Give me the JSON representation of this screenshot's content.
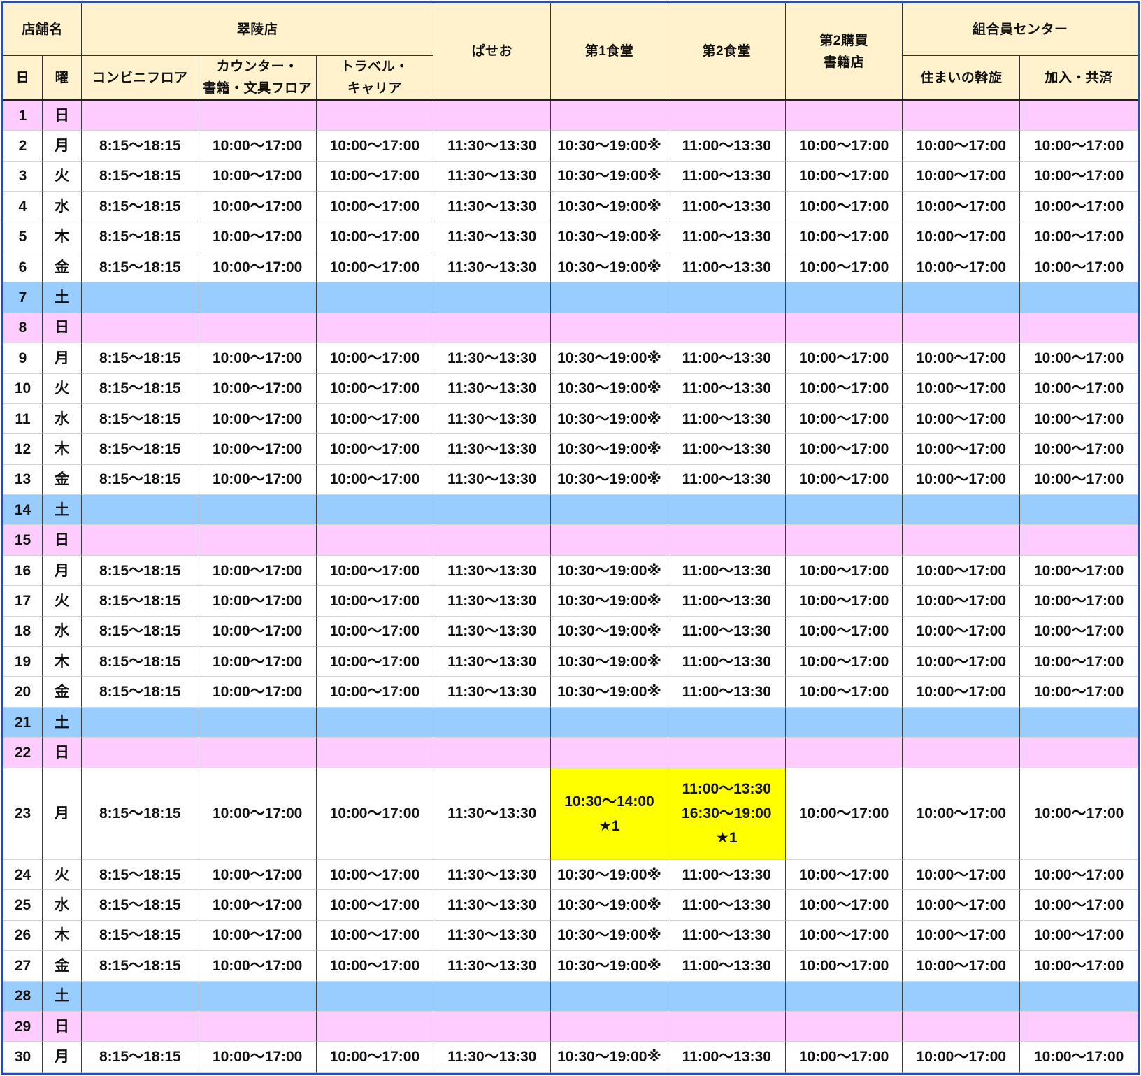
{
  "colors": {
    "frame": "#2B4FA8",
    "header_bg": "#FFF2CC",
    "sunday_bg": "#FFCCFF",
    "saturday_bg": "#99CCFF",
    "highlight_bg": "#FFFF00"
  },
  "header": {
    "store_name": "店舗名",
    "day": "日",
    "weekday": "曜",
    "groups": {
      "suiryo": "翠陵店",
      "member_center": "組合員センター"
    },
    "columns": [
      "コンビニフロア",
      "カウンター・\n書籍・文具フロア",
      "トラベル・\nキャリア",
      "ぱせお",
      "第1食堂",
      "第2食堂",
      "第2購買\n書籍店",
      "住まいの斡旋",
      "加入・共済"
    ]
  },
  "rows": [
    {
      "day": "1",
      "weekday": "日",
      "type": "sunday",
      "cells": []
    },
    {
      "day": "2",
      "weekday": "月",
      "type": "weekday",
      "cells": [
        "8:15～18:15",
        "10:00～17:00",
        "10:00～17:00",
        "11:30～13:30",
        "10:30～19:00※",
        "11:00～13:30",
        "10:00～17:00",
        "10:00～17:00",
        "10:00～17:00"
      ]
    },
    {
      "day": "3",
      "weekday": "火",
      "type": "weekday",
      "cells": [
        "8:15～18:15",
        "10:00～17:00",
        "10:00～17:00",
        "11:30～13:30",
        "10:30～19:00※",
        "11:00～13:30",
        "10:00～17:00",
        "10:00～17:00",
        "10:00～17:00"
      ]
    },
    {
      "day": "4",
      "weekday": "水",
      "type": "weekday",
      "cells": [
        "8:15～18:15",
        "10:00～17:00",
        "10:00～17:00",
        "11:30～13:30",
        "10:30～19:00※",
        "11:00～13:30",
        "10:00～17:00",
        "10:00～17:00",
        "10:00～17:00"
      ]
    },
    {
      "day": "5",
      "weekday": "木",
      "type": "weekday",
      "cells": [
        "8:15～18:15",
        "10:00～17:00",
        "10:00～17:00",
        "11:30～13:30",
        "10:30～19:00※",
        "11:00～13:30",
        "10:00～17:00",
        "10:00～17:00",
        "10:00～17:00"
      ]
    },
    {
      "day": "6",
      "weekday": "金",
      "type": "weekday",
      "cells": [
        "8:15～18:15",
        "10:00～17:00",
        "10:00～17:00",
        "11:30～13:30",
        "10:30～19:00※",
        "11:00～13:30",
        "10:00～17:00",
        "10:00～17:00",
        "10:00～17:00"
      ]
    },
    {
      "day": "7",
      "weekday": "土",
      "type": "saturday",
      "cells": []
    },
    {
      "day": "8",
      "weekday": "日",
      "type": "sunday",
      "cells": []
    },
    {
      "day": "9",
      "weekday": "月",
      "type": "weekday",
      "cells": [
        "8:15～18:15",
        "10:00～17:00",
        "10:00～17:00",
        "11:30～13:30",
        "10:30～19:00※",
        "11:00～13:30",
        "10:00～17:00",
        "10:00～17:00",
        "10:00～17:00"
      ]
    },
    {
      "day": "10",
      "weekday": "火",
      "type": "weekday",
      "cells": [
        "8:15～18:15",
        "10:00～17:00",
        "10:00～17:00",
        "11:30～13:30",
        "10:30～19:00※",
        "11:00～13:30",
        "10:00～17:00",
        "10:00～17:00",
        "10:00～17:00"
      ]
    },
    {
      "day": "11",
      "weekday": "水",
      "type": "weekday",
      "cells": [
        "8:15～18:15",
        "10:00～17:00",
        "10:00～17:00",
        "11:30～13:30",
        "10:30～19:00※",
        "11:00～13:30",
        "10:00～17:00",
        "10:00～17:00",
        "10:00～17:00"
      ]
    },
    {
      "day": "12",
      "weekday": "木",
      "type": "weekday",
      "cells": [
        "8:15～18:15",
        "10:00～17:00",
        "10:00～17:00",
        "11:30～13:30",
        "10:30～19:00※",
        "11:00～13:30",
        "10:00～17:00",
        "10:00～17:00",
        "10:00～17:00"
      ]
    },
    {
      "day": "13",
      "weekday": "金",
      "type": "weekday",
      "cells": [
        "8:15～18:15",
        "10:00～17:00",
        "10:00～17:00",
        "11:30～13:30",
        "10:30～19:00※",
        "11:00～13:30",
        "10:00～17:00",
        "10:00～17:00",
        "10:00～17:00"
      ]
    },
    {
      "day": "14",
      "weekday": "土",
      "type": "saturday",
      "cells": []
    },
    {
      "day": "15",
      "weekday": "日",
      "type": "sunday",
      "cells": []
    },
    {
      "day": "16",
      "weekday": "月",
      "type": "weekday",
      "cells": [
        "8:15～18:15",
        "10:00～17:00",
        "10:00～17:00",
        "11:30～13:30",
        "10:30～19:00※",
        "11:00～13:30",
        "10:00～17:00",
        "10:00～17:00",
        "10:00～17:00"
      ]
    },
    {
      "day": "17",
      "weekday": "火",
      "type": "weekday",
      "cells": [
        "8:15～18:15",
        "10:00～17:00",
        "10:00～17:00",
        "11:30～13:30",
        "10:30～19:00※",
        "11:00～13:30",
        "10:00～17:00",
        "10:00～17:00",
        "10:00～17:00"
      ]
    },
    {
      "day": "18",
      "weekday": "水",
      "type": "weekday",
      "cells": [
        "8:15～18:15",
        "10:00～17:00",
        "10:00～17:00",
        "11:30～13:30",
        "10:30～19:00※",
        "11:00～13:30",
        "10:00～17:00",
        "10:00～17:00",
        "10:00～17:00"
      ]
    },
    {
      "day": "19",
      "weekday": "木",
      "type": "weekday",
      "cells": [
        "8:15～18:15",
        "10:00～17:00",
        "10:00～17:00",
        "11:30～13:30",
        "10:30～19:00※",
        "11:00～13:30",
        "10:00～17:00",
        "10:00～17:00",
        "10:00～17:00"
      ]
    },
    {
      "day": "20",
      "weekday": "金",
      "type": "weekday",
      "cells": [
        "8:15～18:15",
        "10:00～17:00",
        "10:00～17:00",
        "11:30～13:30",
        "10:30～19:00※",
        "11:00～13:30",
        "10:00～17:00",
        "10:00～17:00",
        "10:00～17:00"
      ]
    },
    {
      "day": "21",
      "weekday": "土",
      "type": "saturday",
      "cells": []
    },
    {
      "day": "22",
      "weekday": "日",
      "type": "sunday",
      "cells": []
    },
    {
      "day": "23",
      "weekday": "月",
      "type": "weekday",
      "cells": [
        "8:15～18:15",
        "10:00～17:00",
        "10:00～17:00",
        "11:30～13:30",
        "10:30～14:00\n★1",
        "11:00～13:30\n16:30～19:00\n★1",
        "10:00～17:00",
        "10:00～17:00",
        "10:00～17:00"
      ],
      "highlighted_cells": [
        4,
        5
      ]
    },
    {
      "day": "24",
      "weekday": "火",
      "type": "weekday",
      "cells": [
        "8:15～18:15",
        "10:00～17:00",
        "10:00～17:00",
        "11:30～13:30",
        "10:30～19:00※",
        "11:00～13:30",
        "10:00～17:00",
        "10:00～17:00",
        "10:00～17:00"
      ]
    },
    {
      "day": "25",
      "weekday": "水",
      "type": "weekday",
      "cells": [
        "8:15～18:15",
        "10:00～17:00",
        "10:00～17:00",
        "11:30～13:30",
        "10:30～19:00※",
        "11:00～13:30",
        "10:00～17:00",
        "10:00～17:00",
        "10:00～17:00"
      ]
    },
    {
      "day": "26",
      "weekday": "木",
      "type": "weekday",
      "cells": [
        "8:15～18:15",
        "10:00～17:00",
        "10:00～17:00",
        "11:30～13:30",
        "10:30～19:00※",
        "11:00～13:30",
        "10:00～17:00",
        "10:00～17:00",
        "10:00～17:00"
      ]
    },
    {
      "day": "27",
      "weekday": "金",
      "type": "weekday",
      "cells": [
        "8:15～18:15",
        "10:00～17:00",
        "10:00～17:00",
        "11:30～13:30",
        "10:30～19:00※",
        "11:00～13:30",
        "10:00～17:00",
        "10:00～17:00",
        "10:00～17:00"
      ]
    },
    {
      "day": "28",
      "weekday": "土",
      "type": "saturday",
      "cells": []
    },
    {
      "day": "29",
      "weekday": "日",
      "type": "sunday",
      "cells": []
    },
    {
      "day": "30",
      "weekday": "月",
      "type": "weekday",
      "cells": [
        "8:15～18:15",
        "10:00～17:00",
        "10:00～17:00",
        "11:30～13:30",
        "10:30～19:00※",
        "11:00～13:30",
        "10:00～17:00",
        "10:00～17:00",
        "10:00～17:00"
      ]
    }
  ]
}
